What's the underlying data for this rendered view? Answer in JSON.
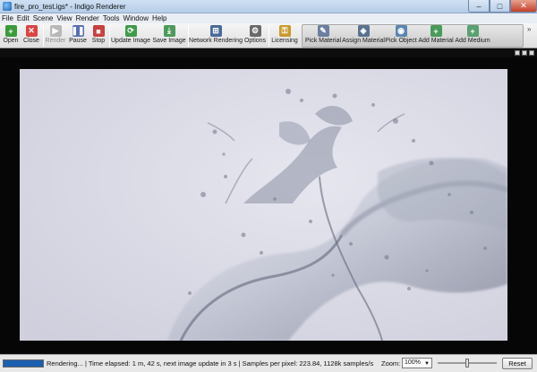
{
  "window": {
    "title": "fire_pro_test.igs* - Indigo Renderer",
    "min": "–",
    "max": "□",
    "close": "✕"
  },
  "menu": [
    "File",
    "Edit",
    "Scene",
    "View",
    "Render",
    "Tools",
    "Window",
    "Help"
  ],
  "toolbar": {
    "open": "Open",
    "close": "Close",
    "render": "Render",
    "pause": "Pause",
    "stop": "Stop",
    "update_image": "Update Image",
    "save_image": "Save Image",
    "network_rendering": "Network Rendering",
    "options": "Options",
    "licensing": "Licensing",
    "pick_material": "Pick Material",
    "assign_material": "Assign Material",
    "pick_object": "Pick Object",
    "add_material": "Add Material",
    "add_medium": "Add Medium",
    "overflow": "»"
  },
  "status": {
    "progress": 0.99,
    "text": "Rendering... | Time elapsed: 1 m, 42 s, next image update in 3 s | Samples per pixel: 223.84, 1128k samples/s",
    "zoom_label": "Zoom:",
    "zoom_value": "100%",
    "zoom_slider": 0.5,
    "reset": "Reset"
  },
  "colors": {
    "accent": "#1b5fb0",
    "render_bg": "#d8d8e6",
    "viewport_bg": "#060606"
  }
}
